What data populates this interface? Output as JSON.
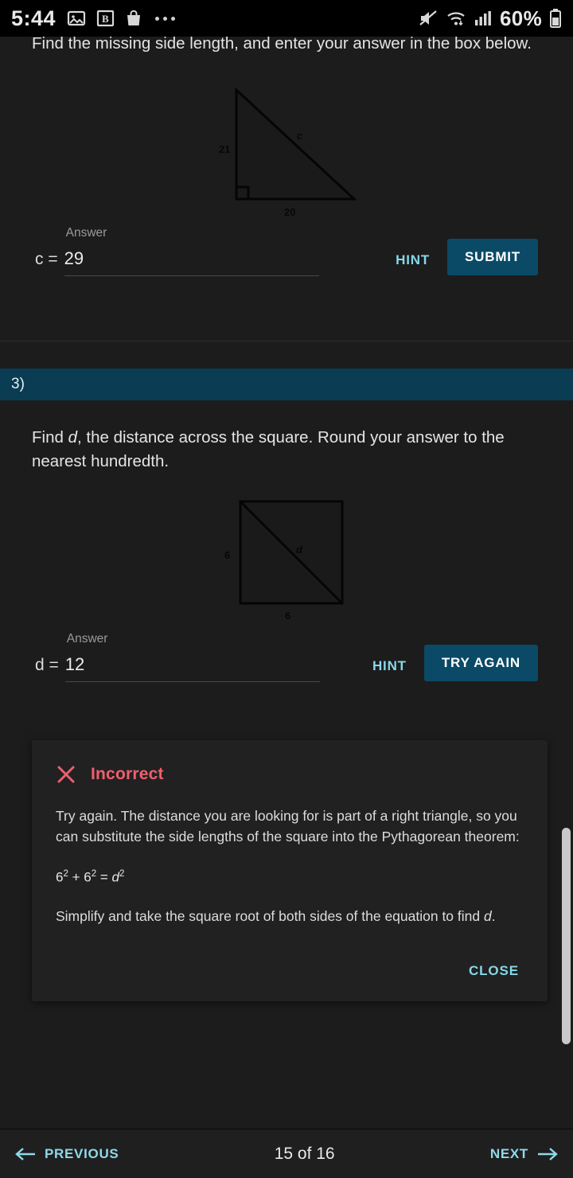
{
  "statusbar": {
    "time": "5:44",
    "icons_left": [
      "image-icon",
      "b-app-icon",
      "shopping-bag-icon",
      "more-dots-icon"
    ],
    "icons_right": [
      "mute-icon",
      "wifi-icon",
      "cellular-signal-icon",
      "battery-icon"
    ],
    "battery_text": "60%"
  },
  "question2": {
    "prompt": "Find the missing side length, and enter your answer in the box below.",
    "figure": {
      "type": "right-triangle",
      "vertical_label": "21",
      "horizontal_label": "20",
      "hypotenuse_label": "c",
      "right_angle_mark": true
    },
    "answer": {
      "variable": "c =",
      "label": "Answer",
      "value": "29",
      "placeholder": ""
    },
    "hint_label": "HINT",
    "action_label": "SUBMIT"
  },
  "question3": {
    "number": "3)",
    "prompt_before": "Find ",
    "prompt_italic": "d",
    "prompt_after": ", the distance across the square. Round your answer to the nearest hundredth.",
    "figure": {
      "type": "square-with-diagonal",
      "left_label": "6",
      "bottom_label": "6",
      "diagonal_label": "d"
    },
    "answer": {
      "variable": "d =",
      "label": "Answer",
      "value": "12",
      "placeholder": ""
    },
    "hint_label": "HINT",
    "action_label": "TRY AGAIN"
  },
  "dialog": {
    "icon": "x-mark-icon",
    "title": "Incorrect",
    "body": "Try again. The distance you are looking for is part of a right triangle, so you can substitute the side lengths of the square into the Pythagorean theorem:",
    "equation": {
      "term1_base": "6",
      "term1_exp": "2",
      "plus": " + ",
      "term2_base": "6",
      "term2_exp": "2",
      "equals": " = ",
      "term3_base": "d",
      "term3_exp": "2"
    },
    "note_before": "Simplify and take the square root of both sides of the equation to find ",
    "note_italic": "d",
    "note_after": ".",
    "close_label": "CLOSE"
  },
  "bottomnav": {
    "previous_label": "PREVIOUS",
    "page_indicator": "15 of 16",
    "next_label": "NEXT"
  },
  "colors": {
    "accent_cyan": "#86d8e8",
    "primary_button": "#0b4a66",
    "header_bar": "#0a3c53",
    "incorrect_red": "#ef5f6e",
    "page_bg": "#1c1c1c"
  }
}
